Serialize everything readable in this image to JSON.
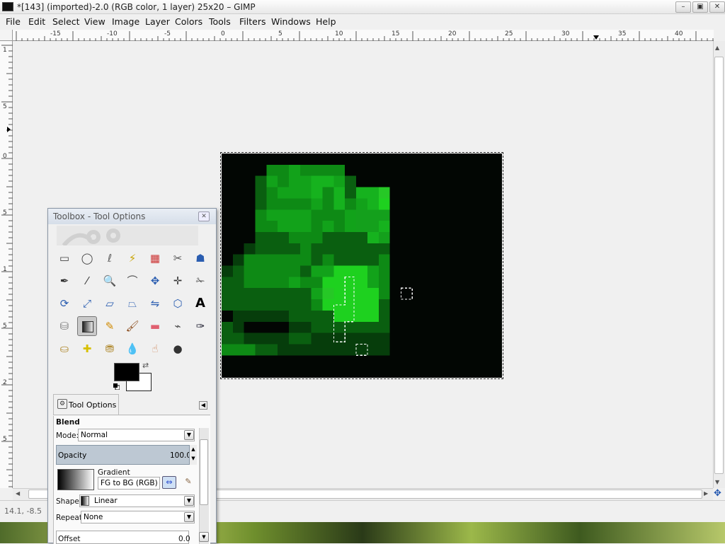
{
  "window": {
    "title": "*[143] (imported)-2.0 (RGB color, 1 layer) 25x20 – GIMP",
    "buttons": {
      "minimize": "–",
      "restore": "▣",
      "close": "✕"
    }
  },
  "menubar": {
    "items": [
      "File",
      "Edit",
      "Select",
      "View",
      "Image",
      "Layer",
      "Colors",
      "Tools",
      "Filters",
      "Windows",
      "Help"
    ]
  },
  "ruler_top": {
    "labels": [
      "-15",
      "-10",
      "-5",
      "0",
      "5",
      "10",
      "15",
      "20",
      "25",
      "30",
      "35",
      "40"
    ]
  },
  "ruler_left": {
    "labels": [
      "1",
      "5",
      "0",
      "5",
      "1",
      "5",
      "2",
      "5"
    ]
  },
  "canvas": {
    "image_size": "25x20",
    "pixels": [
      "0000000000000000000000000",
      "0000334333300000000000000",
      "0002434455420000000000000",
      "0002344453525580000000000",
      "0002333343534570000000000",
      "0003444433346660000000000",
      "0003344434346650000000000",
      "0002223332222560000000000",
      "0012222322222220000000000",
      "0133333323222230000000000",
      "1233333244777430000000000",
      "2233334337777430000000000",
      "2222222248777730000000000",
      "2222222237777720000000000",
      "0111112222777720000000000",
      "2100001122222220000000000",
      "2211112211111110000000000",
      "3332211111111110000000000",
      "0000000000000000000000000",
      "0000000000000000000000000"
    ],
    "palette": [
      "#020603",
      "#063d0b",
      "#0a5f10",
      "#0e8a15",
      "#12a21a",
      "#16b21e",
      "#14a01c",
      "#1ed11f",
      "#26c826"
    ]
  },
  "status": {
    "coords": "14.1, -8.5"
  },
  "toolbox": {
    "title": "Toolbox - Tool Options",
    "tools": [
      [
        "rect-select-icon",
        "ellipse-select-icon",
        "lasso-icon",
        "magic-wand-icon",
        "select-by-color-icon",
        "scissors-icon",
        "foreground-select-icon"
      ],
      [
        "paths-icon",
        "color-picker-icon",
        "zoom-icon",
        "measure-icon",
        "move-icon",
        "align-icon",
        "crop-icon"
      ],
      [
        "rotate-icon",
        "scale-icon",
        "shear-icon",
        "perspective-icon",
        "flip-icon",
        "cage-icon",
        "text-icon"
      ],
      [
        "bucket-fill-icon",
        "blend-icon",
        "pencil-icon",
        "paintbrush-icon",
        "eraser-icon",
        "airbrush-icon",
        "ink-icon"
      ],
      [
        "clone-icon",
        "heal-icon",
        "perspective-clone-icon",
        "blur-icon",
        "smudge-icon",
        "dodge-burn-icon"
      ]
    ],
    "active_tool": "blend-icon",
    "fg_color": "#000000",
    "bg_color": "#ffffff"
  },
  "tool_options": {
    "tab_label": "Tool Options",
    "section": "Blend",
    "mode_label": "Mode:",
    "mode_value": "Normal",
    "opacity_label": "Opacity",
    "opacity_value": "100.0",
    "gradient_label": "Gradient",
    "gradient_value": "FG to BG (RGB)",
    "shape_label": "Shape:",
    "shape_value": "Linear",
    "repeat_label": "Repeat:",
    "repeat_value": "None",
    "offset_label": "Offset",
    "offset_value": "0.0"
  }
}
